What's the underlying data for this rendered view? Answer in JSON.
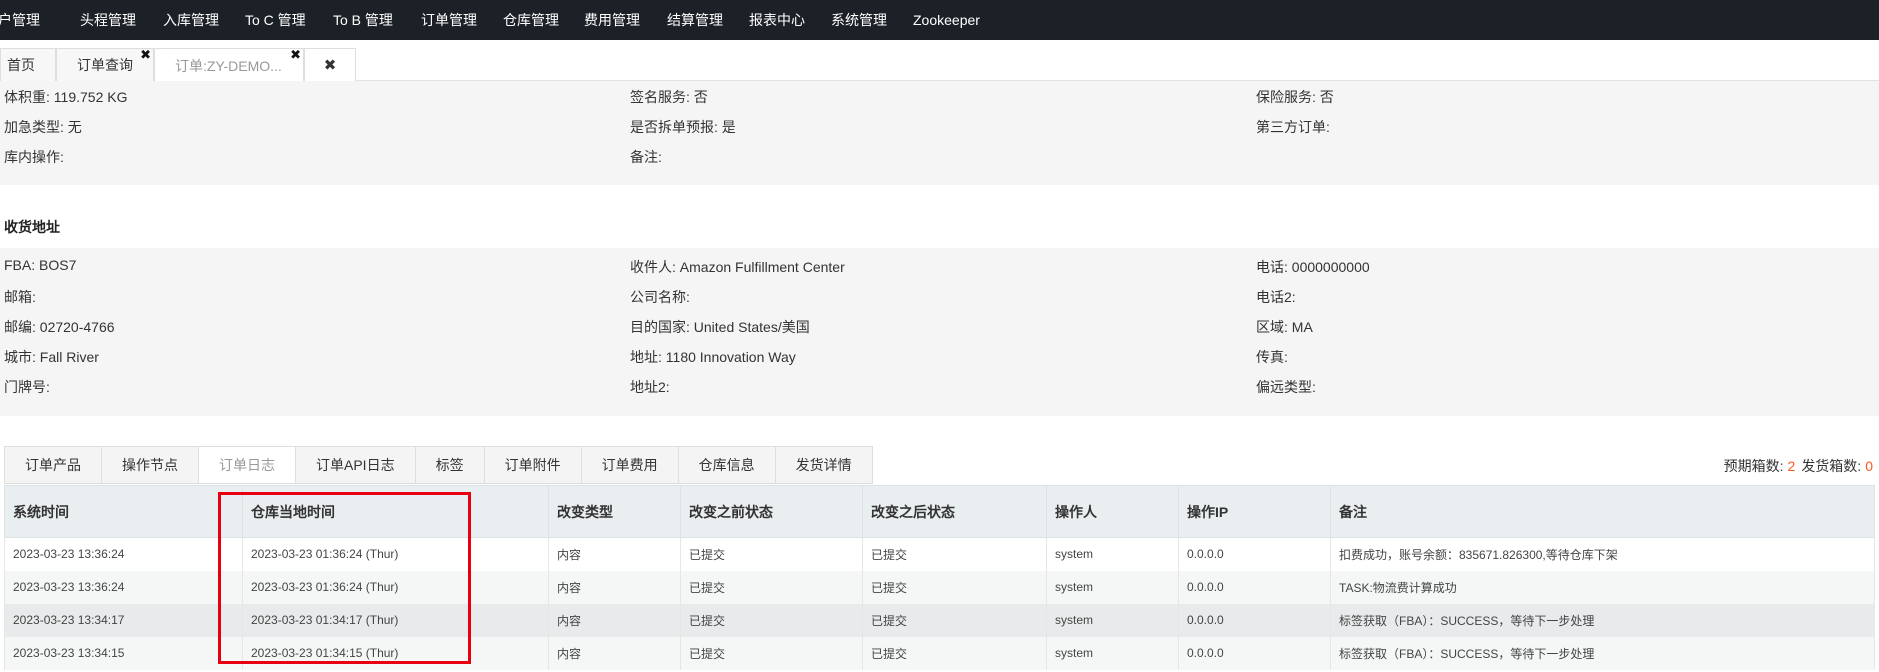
{
  "topnav": {
    "items": [
      "客户管理",
      "头程管理",
      "入库管理",
      "To C 管理",
      "To B 管理",
      "订单管理",
      "仓库管理",
      "费用管理",
      "结算管理",
      "报表中心",
      "系统管理",
      "Zookeeper"
    ]
  },
  "tabs": {
    "home": "首页",
    "order_query": "订单查询",
    "order_detail": "订单:ZY-DEMO...",
    "close_symbol": "✖"
  },
  "info": {
    "volume_weight_label": "体积重:",
    "volume_weight_value": "119.752 KG",
    "signature_label": "签名服务:",
    "signature_value": "否",
    "insurance_label": "保险服务:",
    "insurance_value": "否",
    "rush_label": "加急类型:",
    "rush_value": "无",
    "split_label": "是否拆单预报:",
    "split_value": "是",
    "third_party_label": "第三方订单:",
    "warehouse_op_label": "库内操作:",
    "remark_label": "备注:"
  },
  "address": {
    "title": "收货地址",
    "fba_label": "FBA:",
    "fba_value": "BOS7",
    "recipient_label": "收件人:",
    "recipient_value": "Amazon Fulfillment Center",
    "phone_label": "电话:",
    "phone_value": "0000000000",
    "email_label": "邮箱:",
    "company_label": "公司名称:",
    "phone2_label": "电话2:",
    "zip_label": "邮编:",
    "zip_value": "02720-4766",
    "country_label": "目的国家:",
    "country_value": "United States/美国",
    "region_label": "区域:",
    "region_value": "MA",
    "city_label": "城市:",
    "city_value": "Fall River",
    "addr_label": "地址:",
    "addr_value": "1180 Innovation Way",
    "fax_label": "传真:",
    "door_label": "门牌号:",
    "addr2_label": "地址2:",
    "remote_label": "偏远类型:"
  },
  "subtabs": [
    "订单产品",
    "操作节点",
    "订单日志",
    "订单API日志",
    "标签",
    "订单附件",
    "订单费用",
    "仓库信息",
    "发货详情"
  ],
  "boxcount": {
    "expected_label": "预期箱数:",
    "expected_value": "2",
    "shipped_label": "发货箱数:",
    "shipped_value": "0"
  },
  "log_table": {
    "headers": [
      "系统时间",
      "仓库当地时间",
      "改变类型",
      "改变之前状态",
      "改变之后状态",
      "操作人",
      "操作IP",
      "备注"
    ],
    "rows": [
      [
        "2023-03-23 13:36:24",
        "2023-03-23 01:36:24 (Thur)",
        "内容",
        "已提交",
        "已提交",
        "system",
        "0.0.0.0",
        "扣费成功，账号余额：835671.826300,等待仓库下架"
      ],
      [
        "2023-03-23 13:36:24",
        "2023-03-23 01:36:24 (Thur)",
        "内容",
        "已提交",
        "已提交",
        "system",
        "0.0.0.0",
        "TASK:物流费计算成功"
      ],
      [
        "2023-03-23 13:34:17",
        "2023-03-23 01:34:17 (Thur)",
        "内容",
        "已提交",
        "已提交",
        "system",
        "0.0.0.0",
        "标签获取（FBA）：SUCCESS，等待下一步处理"
      ],
      [
        "2023-03-23 13:34:15",
        "2023-03-23 01:34:15 (Thur)",
        "内容",
        "已提交",
        "已提交",
        "system",
        "0.0.0.0",
        "标签获取（FBA）：SUCCESS，等待下一步处理"
      ]
    ]
  },
  "colors": {
    "nav_bg": "#1c2127",
    "highlight_border": "#e60012",
    "count_accent": "#ff5722"
  }
}
